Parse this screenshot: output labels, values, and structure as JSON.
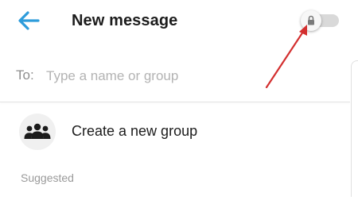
{
  "header": {
    "back_icon": "arrow-left-icon",
    "title": "New message",
    "secret_toggle": {
      "icon": "lock-icon",
      "state": "off"
    }
  },
  "compose": {
    "to_label": "To:",
    "to_placeholder": "Type a name or group",
    "to_value": ""
  },
  "actions": {
    "create_group_icon": "group-icon",
    "create_group_label": "Create a new group"
  },
  "sections": {
    "suggested_label": "Suggested"
  },
  "annotation": {
    "arrow_color": "#d32f2f"
  },
  "colors": {
    "accent": "#2d9cdb",
    "text": "#1c1c1c",
    "muted": "#8e8e8e"
  }
}
